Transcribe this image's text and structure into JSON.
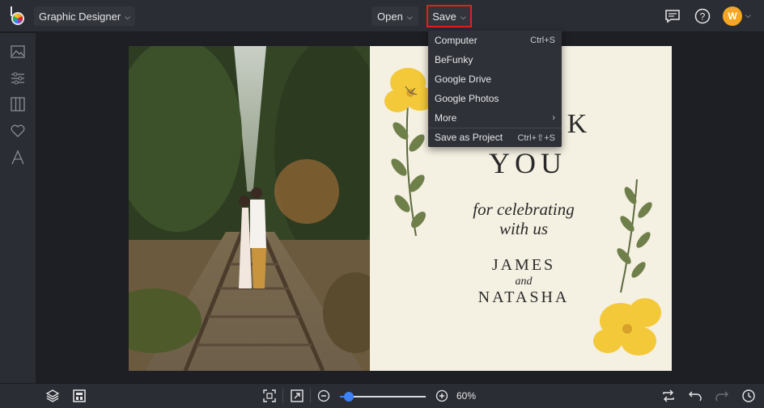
{
  "app": {
    "mode_label": "Graphic Designer"
  },
  "topbar": {
    "open_label": "Open",
    "save_label": "Save",
    "avatar_initial": "W",
    "icons": [
      "logo-icon",
      "feedback-icon",
      "help-icon"
    ]
  },
  "save_menu": {
    "items": [
      {
        "label": "Computer",
        "shortcut": "Ctrl+S"
      },
      {
        "label": "BeFunky",
        "shortcut": ""
      },
      {
        "label": "Google Drive",
        "shortcut": ""
      },
      {
        "label": "Google Photos",
        "shortcut": ""
      },
      {
        "label": "More",
        "shortcut": "›"
      },
      {
        "label": "Save as Project",
        "shortcut": "Ctrl+⇧+S"
      }
    ]
  },
  "sidebar": {
    "icons": [
      "image-icon",
      "sliders-icon",
      "layout-icon",
      "heart-icon",
      "text-icon"
    ]
  },
  "card": {
    "line1_partial": "K",
    "line2": "YOU",
    "script1": "for celebrating",
    "script2": "with us",
    "name1": "JAMES",
    "and": "and",
    "name2": "NATASHA"
  },
  "bottombar": {
    "zoom_percent_label": "60%",
    "zoom_value": 0.1
  },
  "colors": {
    "accent": "#3b82f6",
    "highlight": "#e02020",
    "avatar": "#f5a623",
    "card_bg": "#f4f0e2"
  }
}
